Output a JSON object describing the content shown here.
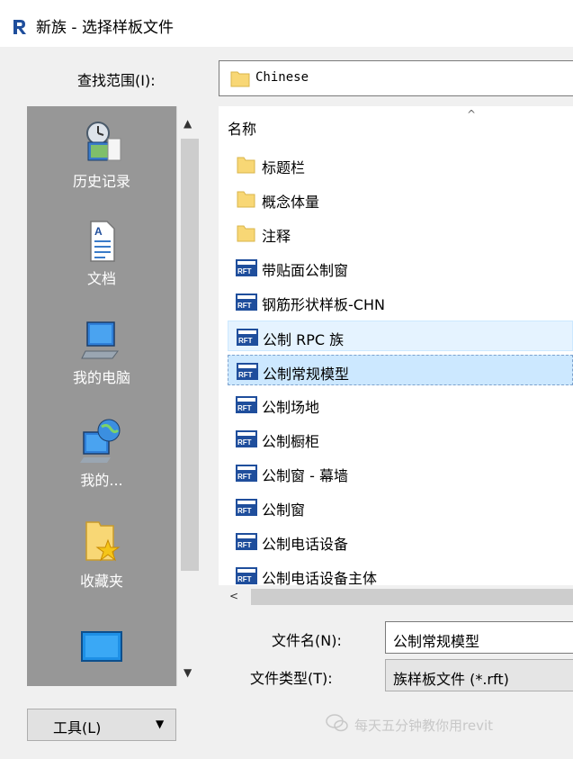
{
  "window": {
    "title": "新族 - 选择样板文件"
  },
  "lookin": {
    "label": "查找范围(I):",
    "value": "Chinese"
  },
  "places": [
    {
      "label": "历史记录",
      "icon": "history-icon"
    },
    {
      "label": "文档",
      "icon": "documents-icon"
    },
    {
      "label": "我的电脑",
      "icon": "my-computer-icon"
    },
    {
      "label": "我的...",
      "icon": "network-icon"
    },
    {
      "label": "收藏夹",
      "icon": "favorites-icon"
    },
    {
      "label": "",
      "icon": "desktop-icon"
    }
  ],
  "filelist": {
    "column_header": "名称",
    "items": [
      {
        "name": "标题栏",
        "type": "folder"
      },
      {
        "name": "概念体量",
        "type": "folder"
      },
      {
        "name": "注释",
        "type": "folder"
      },
      {
        "name": "带贴面公制窗",
        "type": "rft"
      },
      {
        "name": "钢筋形状样板-CHN",
        "type": "rft"
      },
      {
        "name": "公制 RPC 族",
        "type": "rft",
        "state": "hover"
      },
      {
        "name": "公制常规模型",
        "type": "rft",
        "state": "selected"
      },
      {
        "name": "公制场地",
        "type": "rft"
      },
      {
        "name": "公制橱柜",
        "type": "rft"
      },
      {
        "name": "公制窗 - 幕墙",
        "type": "rft"
      },
      {
        "name": "公制窗",
        "type": "rft"
      },
      {
        "name": "公制电话设备",
        "type": "rft"
      },
      {
        "name": "公制电话设备主体",
        "type": "rft"
      }
    ]
  },
  "filename": {
    "label": "文件名(N):",
    "value": "公制常规模型"
  },
  "filetype": {
    "label": "文件类型(T):",
    "value": "族样板文件 (*.rft)"
  },
  "tools": {
    "label": "工具(L)"
  },
  "watermark": {
    "text": "每天五分钟教你用revit"
  },
  "colors": {
    "places_bg": "#979797",
    "selected": "#cce8ff",
    "hover": "#e5f3ff",
    "folder": "#f8d775",
    "rft_icon": "#1f4e9c"
  }
}
